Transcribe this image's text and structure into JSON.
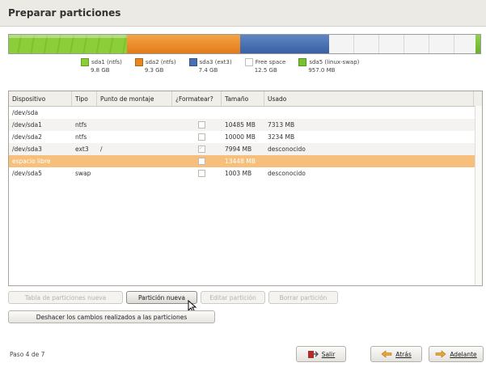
{
  "title": "Preparar particiones",
  "partition_bar": [
    {
      "name": "sda1 (ntfs)",
      "size": "9.8 GB",
      "color": "#8ccd3a",
      "fraction": 0.25
    },
    {
      "name": "sda2 (ntfs)",
      "size": "9.3 GB",
      "color": "#e8871f",
      "fraction": 0.24
    },
    {
      "name": "sda3 (ext3)",
      "size": "7.4 GB",
      "color": "#4a70b3",
      "fraction": 0.19
    },
    {
      "name": "Free space",
      "size": "12.5 GB",
      "color": "#ffffff",
      "fraction": 0.31
    },
    {
      "name": "sda5 (linux-swap)",
      "size": "957.0 MB",
      "color": "#76c230",
      "fraction": 0.01
    }
  ],
  "table": {
    "headers": [
      "Dispositivo",
      "Tipo",
      "Punto de montaje",
      "¿Formatear?",
      "Tamaño",
      "Usado"
    ],
    "rows": [
      {
        "device": "/dev/sda",
        "type": "",
        "mount": "",
        "format": null,
        "size": "",
        "used": ""
      },
      {
        "device": "/dev/sda1",
        "type": "ntfs",
        "mount": "",
        "format": false,
        "size": "10485 MB",
        "used": "7313 MB"
      },
      {
        "device": "/dev/sda2",
        "type": "ntfs",
        "mount": "",
        "format": false,
        "size": "10000 MB",
        "used": "3234 MB"
      },
      {
        "device": "/dev/sda3",
        "type": "ext3",
        "mount": "/",
        "format": true,
        "size": "7994 MB",
        "used": "desconocido"
      },
      {
        "device": "espacio libre",
        "type": "",
        "mount": "",
        "format": false,
        "size": "13448 MB",
        "used": "",
        "selected": true
      },
      {
        "device": "/dev/sda5",
        "type": "swap",
        "mount": "",
        "format": false,
        "size": "1003 MB",
        "used": "desconocido"
      }
    ]
  },
  "buttons": {
    "new_table": "Tabla de particiones nueva",
    "new_partition": "Partición nueva",
    "edit_partition": "Editar partición",
    "delete_partition": "Borrar partición",
    "undo": "Deshacer los cambios realizados a las particiones"
  },
  "footer": {
    "step": "Paso 4 de 7",
    "quit": "Salir",
    "back": "Atrás",
    "forward": "Adelante"
  },
  "colors": {
    "selected_row": "#f6c07c"
  }
}
